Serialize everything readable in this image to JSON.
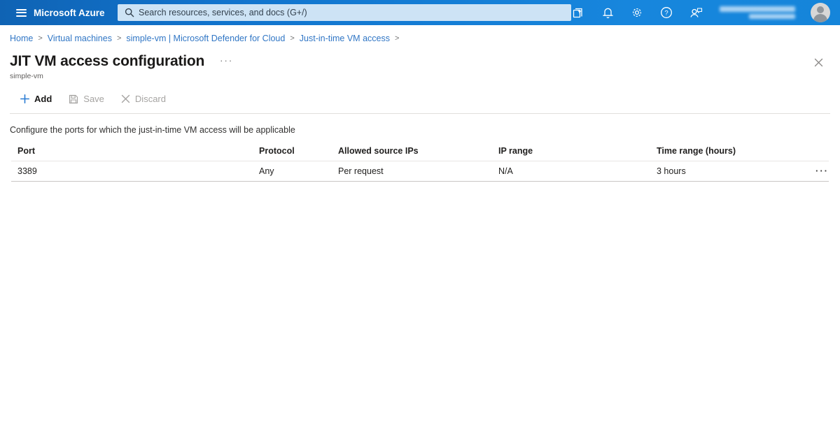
{
  "topbar": {
    "brand": "Microsoft Azure",
    "search": {
      "placeholder": "Search resources, services, and docs (G+/)"
    },
    "icon_names": [
      "cloud-shell",
      "directory-subscription-filter",
      "notifications",
      "settings",
      "help",
      "feedback"
    ],
    "colors": {
      "bar_left": "#0f63b4",
      "bar_right": "#1585da",
      "search_bg": "#cde3f5",
      "icon": "#ffffff"
    }
  },
  "breadcrumb": {
    "separator": ">",
    "items": [
      {
        "label": "Home"
      },
      {
        "label": "Virtual machines"
      },
      {
        "label": "simple-vm | Microsoft Defender for Cloud"
      },
      {
        "label": "Just-in-time VM access"
      }
    ]
  },
  "page": {
    "title": "JIT VM access configuration",
    "subtitle": "simple-vm"
  },
  "icons": {
    "more_glyph": "···",
    "close_name": "close-icon",
    "search_name": "search-icon"
  },
  "toolbar": {
    "add_label": "Add",
    "save_label": "Save",
    "discard_label": "Discard"
  },
  "main": {
    "description": "Configure the ports for which the just-in-time VM access will be applicable"
  },
  "table": {
    "columns": [
      "Port",
      "Protocol",
      "Allowed source IPs",
      "IP range",
      "Time range (hours)"
    ],
    "rows": [
      {
        "port": "3389",
        "protocol": "Any",
        "allowed_source_ips": "Per request",
        "ip_range": "N/A",
        "time_range": "3 hours"
      }
    ]
  },
  "colors": {
    "accent": "#0078d4",
    "breadcrumb_link": "#3076c5",
    "disabled_text": "#a6a4a2",
    "title_text": "#1b1a19",
    "divider": "#e1dfdd"
  }
}
